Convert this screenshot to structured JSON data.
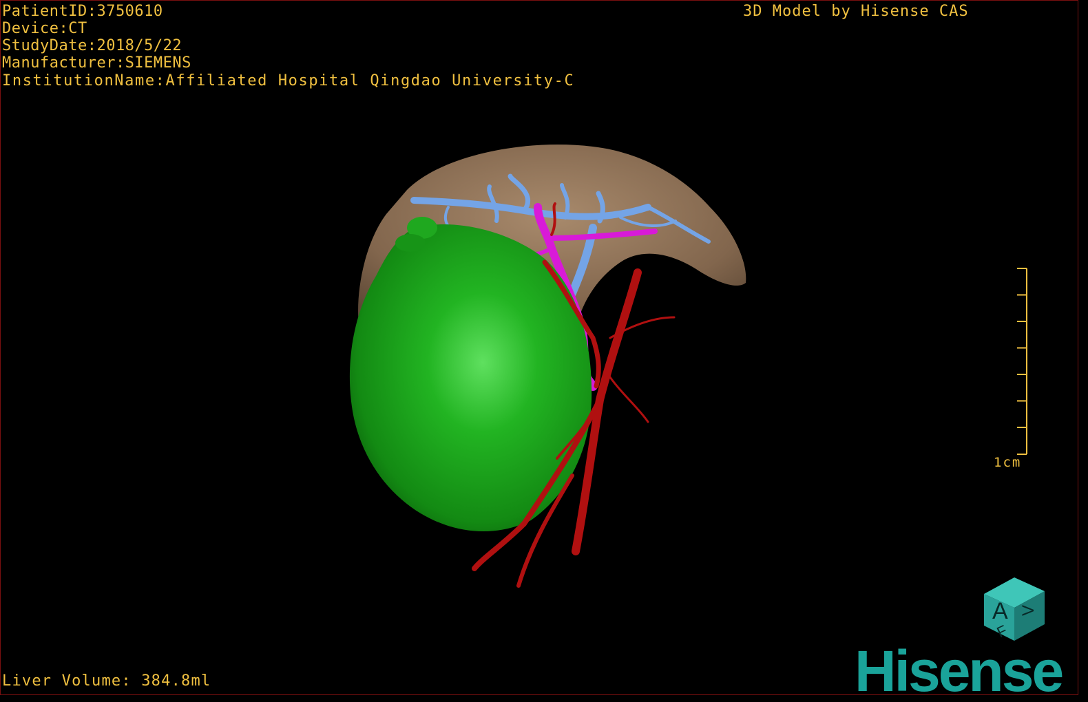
{
  "dicom_info": {
    "patient_id": "PatientID:3750610",
    "device": "Device:CT",
    "study_date": "StudyDate:2018/5/22",
    "manufacturer": "Manufacturer:SIEMENS",
    "institution": "InstitutionName:Affiliated Hospital Qingdao University-C"
  },
  "model_credit": "3D Model by Hisense CAS",
  "liver_volume": "Liver Volume: 384.8ml",
  "scale_bar": {
    "label": "1cm",
    "color": "#f0c040"
  },
  "orientation_cube": {
    "front_label": "A",
    "bottom_label": "F",
    "side_label": "V",
    "color": "#2aa39a"
  },
  "brand": {
    "name": "Hisense",
    "color": "#1aa39a"
  },
  "model_colors": {
    "liver": "#8a6e55",
    "tumor": "#1fa81f",
    "hepatic_vein": "#6f9fe0",
    "portal_vein": "#d81ad8",
    "artery": "#b01010"
  }
}
